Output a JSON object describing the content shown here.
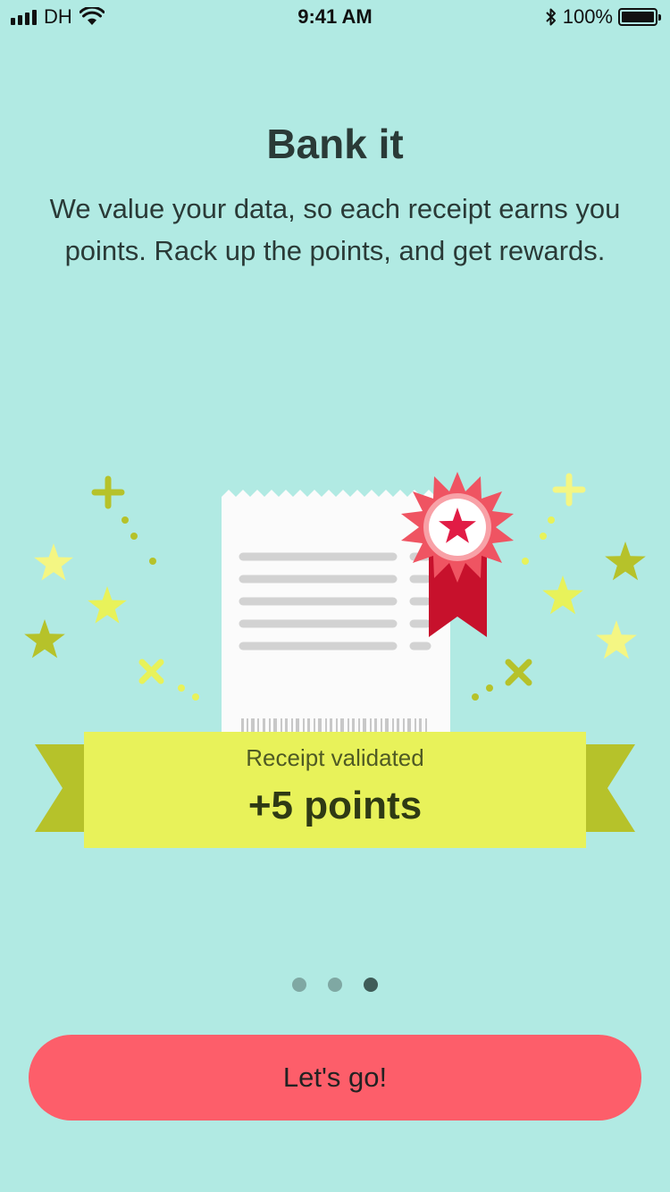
{
  "status_bar": {
    "carrier": "DH",
    "time": "9:41 AM",
    "battery": "100%",
    "icons": [
      "signal-icon",
      "wifi-icon",
      "bluetooth-icon",
      "battery-icon"
    ]
  },
  "onboarding": {
    "title": "Bank it",
    "description": "We value your data, so each receipt earns you points. Rack up the points, and get rewards."
  },
  "illustration": {
    "banner_subtitle": "Receipt validated",
    "banner_points": "+5 points",
    "icons": [
      "receipt-icon",
      "rosette-icon",
      "star-icon",
      "plus-icon",
      "cross-icon"
    ]
  },
  "pager": {
    "total_pages": 3,
    "current_page": 3
  },
  "cta": {
    "label": "Let's go!"
  },
  "colors": {
    "background": "#b1eae3",
    "cta": "#fd5e6a",
    "banner": "#e8f25a",
    "banner_tail": "#b6c22a",
    "rosette": "#ef5462",
    "ribbon": "#c7112c",
    "text": "#2a3a37"
  }
}
